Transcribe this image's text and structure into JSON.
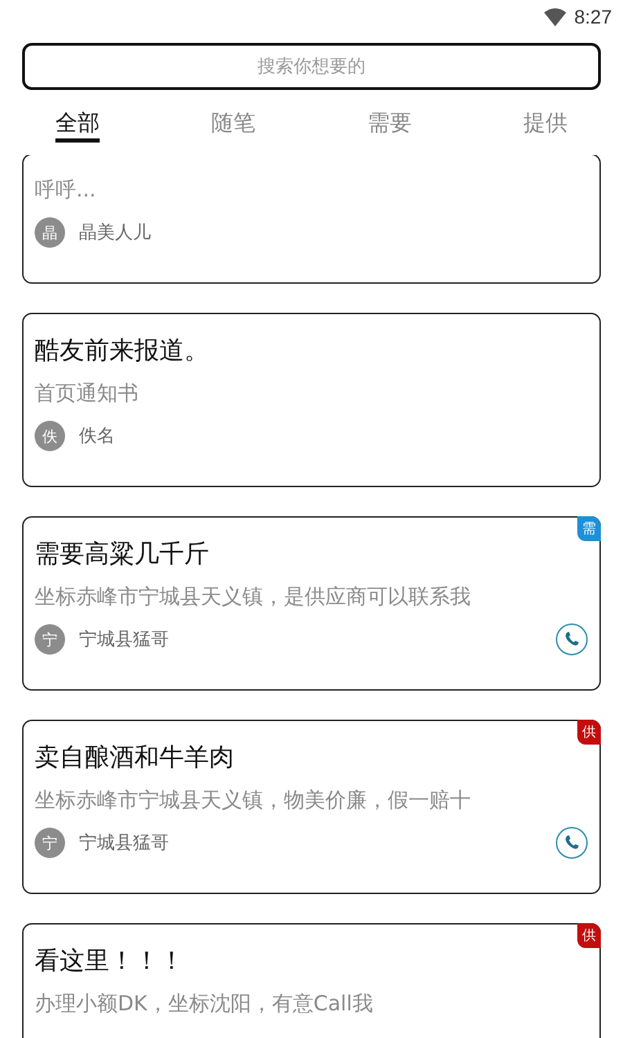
{
  "status_bar": {
    "time": "8:27"
  },
  "search": {
    "placeholder": "搜索你想要的"
  },
  "tabs": [
    {
      "label": "全部",
      "selected": true
    },
    {
      "label": "随笔",
      "selected": false
    },
    {
      "label": "需要",
      "selected": false
    },
    {
      "label": "提供",
      "selected": false
    }
  ],
  "posts": [
    {
      "body": "呼呼...",
      "avatar": "晶",
      "author": "晶美人儿",
      "phone": false
    },
    {
      "title": "酷友前来报道。",
      "body": "首页通知书",
      "avatar": "佚",
      "author": "佚名",
      "phone": false
    },
    {
      "title": "需要高粱几千斤",
      "body": "坐标赤峰市宁城县天义镇，是供应商可以联系我",
      "avatar": "宁",
      "author": "宁城县猛哥",
      "phone": true,
      "badge": {
        "kind": "need",
        "label": "需"
      }
    },
    {
      "title": "卖自酿酒和牛羊肉",
      "body": "坐标赤峰市宁城县天义镇，物美价廉，假一赔十",
      "avatar": "宁",
      "author": "宁城县猛哥",
      "phone": true,
      "badge": {
        "kind": "offer",
        "label": "供"
      }
    },
    {
      "title": "看这里！！！",
      "body": "办理小额DK，坐标沈阳，有意Call我",
      "badge": {
        "kind": "offer",
        "label": "供"
      }
    }
  ]
}
